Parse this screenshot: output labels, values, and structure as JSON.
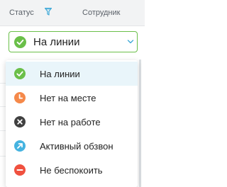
{
  "table_header": {
    "status_label": "Статус",
    "employee_label": "Сотрудник"
  },
  "status_select": {
    "selected_label": "На линии",
    "selected_icon": "check-circle-icon",
    "accent_color": "#6abf49"
  },
  "status_options": [
    {
      "label": "На линии",
      "icon": "check-circle-icon",
      "color": "#6abf49",
      "selected": true
    },
    {
      "label": "Нет на месте",
      "icon": "clock-circle-icon",
      "color": "#f5894a",
      "selected": false
    },
    {
      "label": "Нет на работе",
      "icon": "x-circle-icon",
      "color": "#404040",
      "selected": false
    },
    {
      "label": "Активный обзвон",
      "icon": "arrow-up-right-circle-icon",
      "color": "#45b3e0",
      "selected": false
    },
    {
      "label": "Не беспокоить",
      "icon": "minus-circle-icon",
      "color": "#f0513f",
      "selected": false
    }
  ]
}
